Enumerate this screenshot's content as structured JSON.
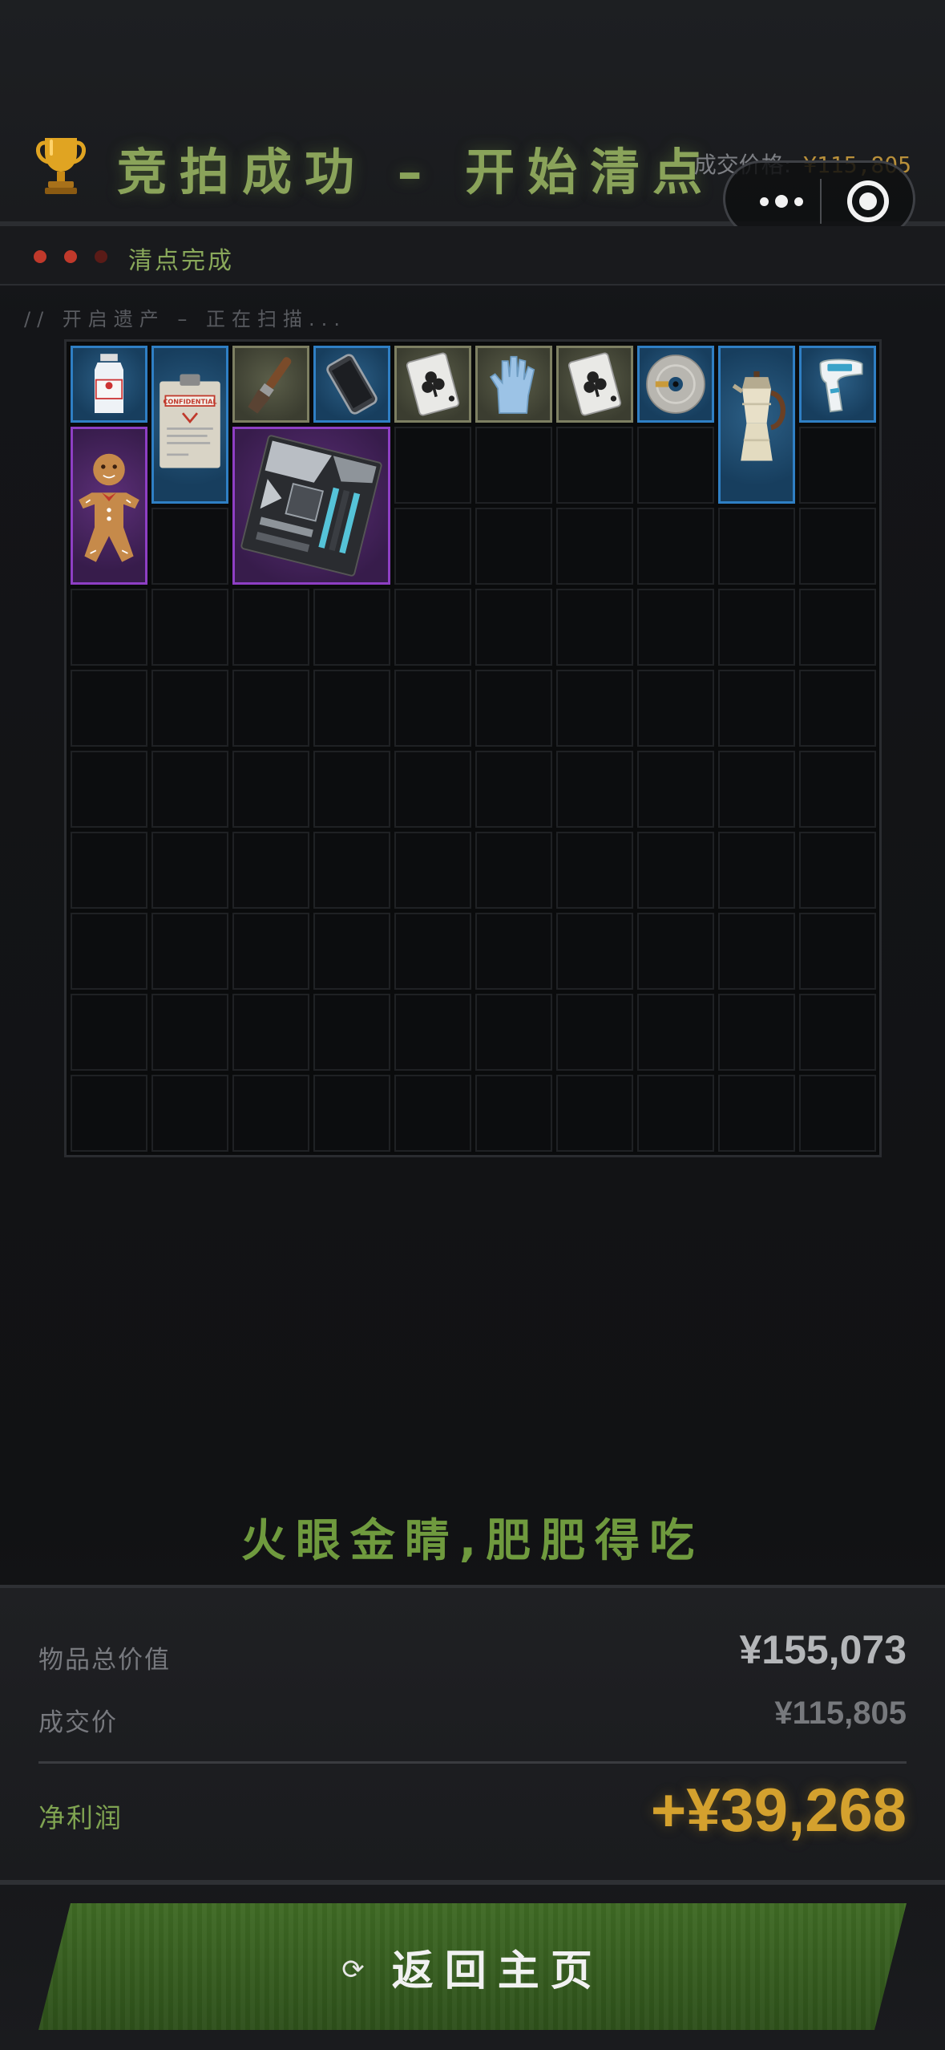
{
  "header": {
    "title": "竞拍成功 – 开始清点",
    "price_label": "成交价格:",
    "price_value": "¥115,805"
  },
  "status": {
    "dots": [
      "#c0392b",
      "#c0392b",
      "#5a1b17"
    ],
    "text": "清点完成"
  },
  "scan_text": "// 开启遗产 – 正在扫描...",
  "grid": {
    "columns": 10,
    "rows": 10
  },
  "items": [
    {
      "name": "water-bottle-item",
      "rarity": "blue",
      "col": 0,
      "row": 0,
      "w": 1,
      "h": 1
    },
    {
      "name": "confidential-clipboard-item",
      "rarity": "blue",
      "col": 1,
      "row": 0,
      "w": 1,
      "h": 2,
      "label": "CONFIDENTIAL"
    },
    {
      "name": "paint-brush-item",
      "rarity": "olive",
      "col": 2,
      "row": 0,
      "w": 1,
      "h": 1
    },
    {
      "name": "phone-item",
      "rarity": "blue",
      "col": 3,
      "row": 0,
      "w": 1,
      "h": 1
    },
    {
      "name": "playing-card-item",
      "rarity": "olive",
      "col": 4,
      "row": 0,
      "w": 1,
      "h": 1
    },
    {
      "name": "rubber-glove-item",
      "rarity": "olive",
      "col": 5,
      "row": 0,
      "w": 1,
      "h": 1
    },
    {
      "name": "playing-card-item",
      "rarity": "olive",
      "col": 6,
      "row": 0,
      "w": 1,
      "h": 1
    },
    {
      "name": "cd-disc-item",
      "rarity": "blue",
      "col": 7,
      "row": 0,
      "w": 1,
      "h": 1
    },
    {
      "name": "moka-pot-item",
      "rarity": "blue",
      "col": 8,
      "row": 0,
      "w": 1,
      "h": 2
    },
    {
      "name": "thermometer-gun-item",
      "rarity": "blue",
      "col": 9,
      "row": 0,
      "w": 1,
      "h": 1
    },
    {
      "name": "gingerbread-man-item",
      "rarity": "purple",
      "col": 0,
      "row": 1,
      "w": 1,
      "h": 2
    },
    {
      "name": "motherboard-item",
      "rarity": "purple",
      "col": 2,
      "row": 1,
      "w": 2,
      "h": 2
    }
  ],
  "slogan": "火眼金睛,肥肥得吃",
  "summary": {
    "total_label": "物品总价值",
    "total_value": "¥155,073",
    "deal_label": "成交价",
    "deal_value": "¥115,805",
    "profit_label": "净利润",
    "profit_value": "+¥39,268"
  },
  "home_button": {
    "icon": "refresh-icon",
    "label": "返回主页"
  },
  "colors": {
    "accent_green": "#8aa35a",
    "gold": "#d4a12e",
    "rarity_blue": "#2f7fc4",
    "rarity_olive": "#7d7f62",
    "rarity_purple": "#8e3fc4"
  }
}
